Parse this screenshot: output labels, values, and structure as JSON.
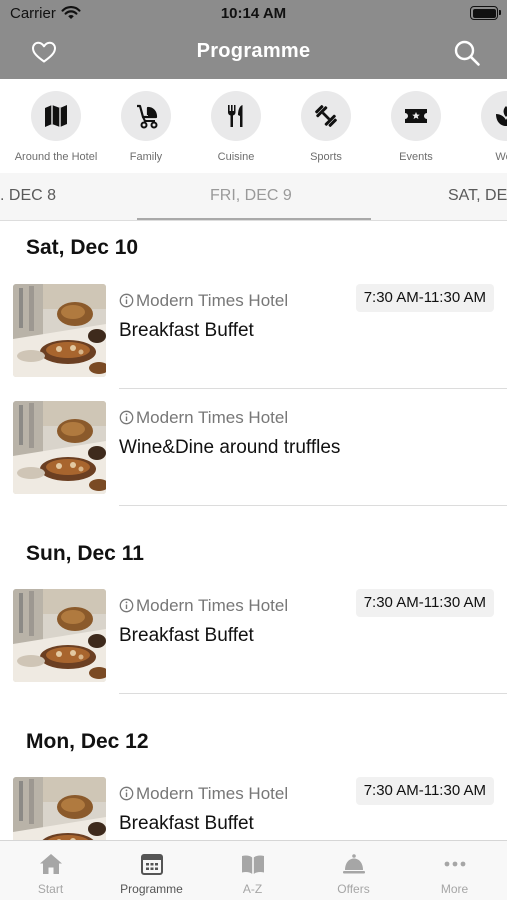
{
  "status_bar": {
    "carrier": "Carrier",
    "time": "10:14 AM"
  },
  "nav": {
    "title": "Programme",
    "left_icon": "heart-icon",
    "right_icon": "search-icon"
  },
  "categories": [
    {
      "label": "Around the Hotel",
      "icon": "map-icon"
    },
    {
      "label": "Family",
      "icon": "stroller-icon"
    },
    {
      "label": "Cuisine",
      "icon": "cutlery-icon"
    },
    {
      "label": "Sports",
      "icon": "dumbbell-icon"
    },
    {
      "label": "Events",
      "icon": "ticket-icon"
    },
    {
      "label": "Well",
      "icon": "wellness-icon"
    }
  ],
  "date_tabs": [
    {
      "label": ". DEC 8"
    },
    {
      "label": "FRI, DEC 9",
      "selected": true
    },
    {
      "label": "SAT, DE"
    }
  ],
  "days": [
    {
      "title": "Sat, Dec 10",
      "events": [
        {
          "venue": "Modern Times Hotel",
          "title": "Breakfast Buffet",
          "time": "7:30 AM-11:30 AM"
        },
        {
          "venue": "Modern Times Hotel",
          "title": "Wine&Dine around truffles",
          "time": ""
        }
      ]
    },
    {
      "title": "Sun, Dec 11",
      "events": [
        {
          "venue": "Modern Times Hotel",
          "title": "Breakfast Buffet",
          "time": "7:30 AM-11:30 AM"
        }
      ]
    },
    {
      "title": "Mon, Dec 12",
      "events": [
        {
          "venue": "Modern Times Hotel",
          "title": "Breakfast Buffet",
          "time": "7:30 AM-11:30 AM"
        }
      ]
    }
  ],
  "tabbar": [
    {
      "label": "Start",
      "icon": "house-icon"
    },
    {
      "label": "Programme",
      "icon": "calendar-icon",
      "active": true
    },
    {
      "label": "A-Z",
      "icon": "book-icon"
    },
    {
      "label": "Offers",
      "icon": "bell-icon"
    },
    {
      "label": "More",
      "icon": "more-icon"
    }
  ],
  "colors": {
    "nav_bg": "#8c8c8c",
    "icon_circle": "#e9e9ea",
    "time_badge": "#f1f1f1",
    "tab_inactive": "#a6a6a6"
  }
}
